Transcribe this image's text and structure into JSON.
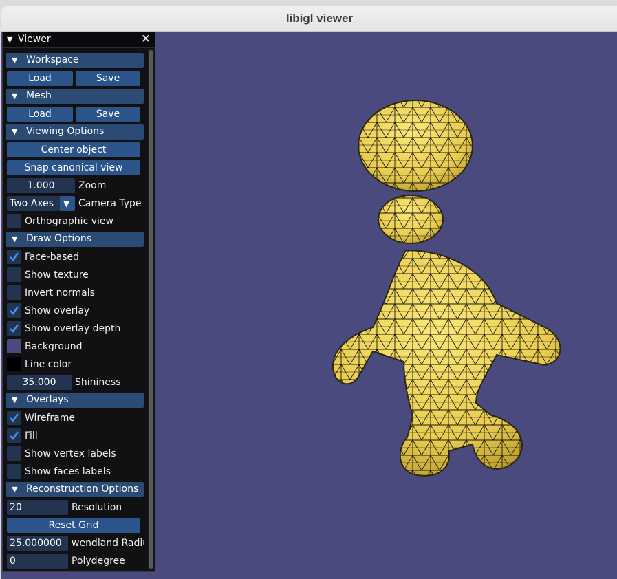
{
  "window": {
    "title": "libigl viewer"
  },
  "viewer_panel": {
    "title": "Viewer",
    "workspace": {
      "header": "Workspace",
      "load": "Load",
      "save": "Save"
    },
    "mesh": {
      "header": "Mesh",
      "load": "Load",
      "save": "Save"
    },
    "viewing_options": {
      "header": "Viewing Options",
      "center_object": "Center object",
      "snap_canonical_view": "Snap canonical view",
      "zoom_value": "1.000",
      "zoom_label": "Zoom",
      "camera_type_value": "Two Axes",
      "camera_type_label": "Camera Type",
      "orthographic_label": "Orthographic view",
      "orthographic_checked": false
    },
    "draw_options": {
      "header": "Draw Options",
      "face_based": "Face-based",
      "show_texture": "Show texture",
      "invert_normals": "Invert normals",
      "show_overlay": "Show overlay",
      "show_overlay_depth": "Show overlay depth",
      "background": "Background",
      "line_color": "Line color",
      "shininess_value": "35.000",
      "shininess_label": "Shininess",
      "checked": {
        "face_based": true,
        "show_texture": false,
        "invert_normals": false,
        "show_overlay": true,
        "show_overlay_depth": true
      },
      "background_color": "#4b4a7e",
      "line_color_value": "#000000"
    },
    "overlays": {
      "header": "Overlays",
      "wireframe": "Wireframe",
      "fill": "Fill",
      "show_vertex_labels": "Show vertex labels",
      "show_faces_labels": "Show faces labels",
      "checked": {
        "wireframe": true,
        "fill": true,
        "show_vertex_labels": false,
        "show_faces_labels": false
      }
    },
    "reconstruction_options": {
      "header": "Reconstruction Options",
      "resolution_value": "20",
      "resolution_label": "Resolution",
      "reset_grid": "Reset Grid",
      "wendland_radius_value": "25.000000",
      "wendland_radius_label": "wendland Radius",
      "polydegree_value": "0",
      "polydegree_label": "Polydegree"
    }
  },
  "colors": {
    "viewport_bg": "#4b4a7e",
    "mesh_fill": "#f1d65a",
    "header_bg": "#2b4a74",
    "button_bg": "#2b548a",
    "check_accent": "#4296fa"
  },
  "icons": {
    "collapse": "triangle-down-icon",
    "close": "close-icon",
    "check": "checkmark-icon"
  }
}
